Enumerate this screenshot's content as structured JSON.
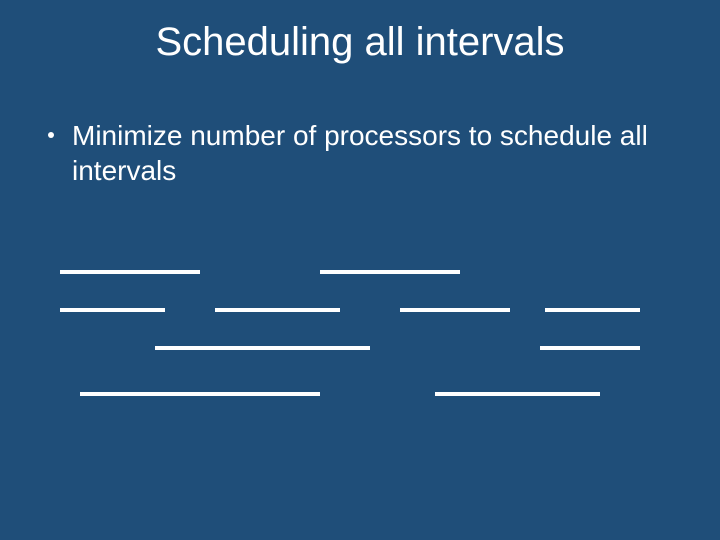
{
  "title": "Scheduling all intervals",
  "bullet_text": "Minimize number of processors to schedule all intervals",
  "intervals": [
    {
      "row": 0,
      "start": 60,
      "end": 200
    },
    {
      "row": 0,
      "start": 320,
      "end": 460
    },
    {
      "row": 1,
      "start": 60,
      "end": 165
    },
    {
      "row": 1,
      "start": 215,
      "end": 340
    },
    {
      "row": 1,
      "start": 400,
      "end": 510
    },
    {
      "row": 1,
      "start": 545,
      "end": 640
    },
    {
      "row": 2,
      "start": 155,
      "end": 370
    },
    {
      "row": 2,
      "start": 540,
      "end": 640
    },
    {
      "row": 3,
      "start": 80,
      "end": 320
    },
    {
      "row": 3,
      "start": 435,
      "end": 600
    }
  ],
  "diagram_layout": {
    "row_y": [
      270,
      308,
      346,
      392
    ],
    "bar_thickness": 4
  }
}
